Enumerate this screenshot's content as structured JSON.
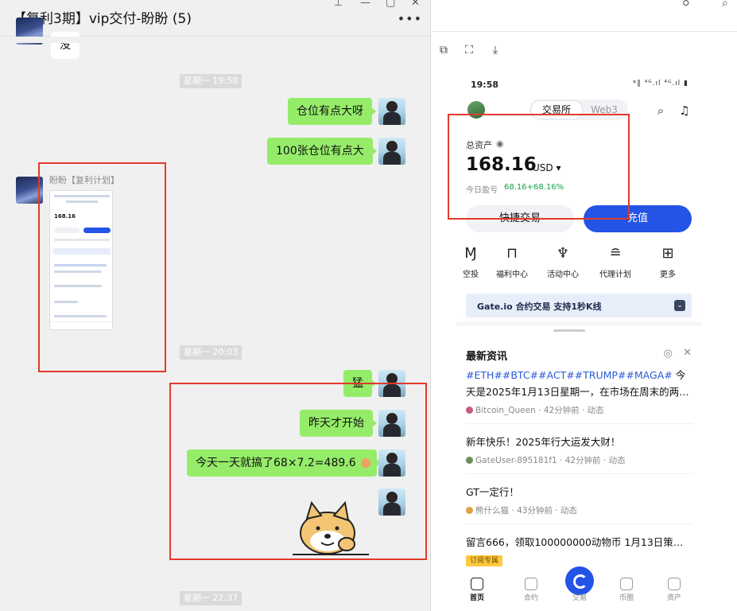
{
  "chat": {
    "title": "【复利3期】vip交付-盼盼 (5)",
    "more_label": "•••",
    "window_controls": [
      "pin-icon",
      "minimize-icon",
      "maximize-icon",
      "close-icon"
    ],
    "top_partial_message": "没",
    "timestamps": [
      "星期一 19:58",
      "星期一 20:03",
      "星期一 22:37"
    ],
    "messages_me": [
      "仓位有点大呀",
      "100张仓位有点大",
      "猛",
      "昨天才开始",
      "今天一天就搞了68×7.2=489.6"
    ],
    "sender_name": "盼盼【复利计划】",
    "colors": {
      "bubble_me": "#95ec69",
      "highlight": "#e33a2c"
    }
  },
  "phone": {
    "status_time": "19:58",
    "status_right": "*‖ ⁴ᴳ.ıl ⁴ᴳ.ıl ▮",
    "seg_exchange": "交易所",
    "seg_web3": "Web3",
    "assets_label": "总资产",
    "assets_value": "168.16",
    "assets_currency": "USD ▾",
    "pnl_label": "今日盈亏",
    "pnl_value": "68.16+68.16%",
    "btn_quick": "快捷交易",
    "btn_deposit": "充值",
    "menu": [
      {
        "label": "空投",
        "icon": "airdrop-icon"
      },
      {
        "label": "福利中心",
        "icon": "gift-icon"
      },
      {
        "label": "活动中心",
        "icon": "trophy-icon"
      },
      {
        "label": "代理计划",
        "icon": "agent-icon"
      },
      {
        "label": "更多",
        "icon": "grid-icon"
      }
    ],
    "banner": "Gate.io 合约交易 支持1秒K线",
    "news_title": "最新资讯",
    "news": [
      {
        "tags": "#ETH##BTC##ACT##TRUMP##MAGA#",
        "text": " 今天是2025年1月13日星期一，在市场在周末的两…",
        "author": "Bitcoin_Queen",
        "time": "42分钟前",
        "kind": "动态"
      },
      {
        "tags": "",
        "text": "新年快乐！2025年行大运发大财！",
        "author": "GateUser-895181f1",
        "time": "42分钟前",
        "kind": "动态"
      },
      {
        "tags": "",
        "text": "GT一定行！",
        "author": "熊什么猫",
        "time": "43分钟前",
        "kind": "动态"
      },
      {
        "tags": "",
        "text": "留言666，领取100000000动物币 1月13日策…",
        "badge": "订阅专属"
      }
    ],
    "tabs": [
      "首页",
      "合约",
      "交易",
      "币圈",
      "资产"
    ],
    "accent": "#2354e6"
  }
}
